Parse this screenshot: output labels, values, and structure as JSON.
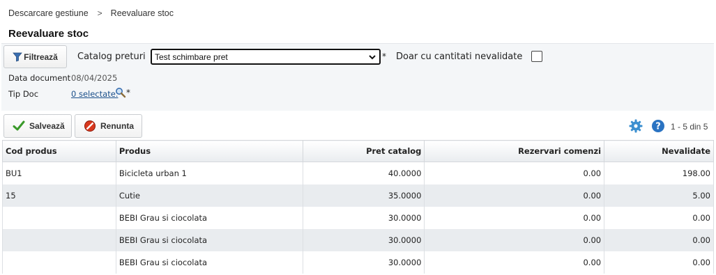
{
  "breadcrumb": {
    "root": "Descarcare gestiune",
    "separator": ">",
    "current": "Reevaluare stoc"
  },
  "page": {
    "title": "Reevaluare stoc"
  },
  "filters": {
    "filter_button": "Filtrează",
    "catalog_label": "Catalog preturi",
    "catalog_value": "Test schimbare pret",
    "required_mark": "*",
    "only_unvalidated_label": "Doar cu cantitati nevalidate",
    "only_unvalidated_checked": false,
    "doc_date_label": "Data document",
    "doc_date_value": "08/04/2025",
    "doc_type_label": "Tip Doc",
    "doc_type_value": "0 selectate."
  },
  "toolbar": {
    "save_label": "Salvează",
    "cancel_label": "Renunta",
    "pager": "1 - 5 din 5"
  },
  "table": {
    "columns": [
      "Cod produs",
      "Produs",
      "Pret catalog",
      "Rezervari comenzi",
      "Nevalidate"
    ],
    "rows": [
      {
        "cod": "BU1",
        "produs": "Bicicleta urban 1",
        "pret": "40.0000",
        "rezervari": "0.00",
        "nevalidate": "198.00"
      },
      {
        "cod": "15",
        "produs": "Cutie",
        "pret": "35.0000",
        "rezervari": "0.00",
        "nevalidate": "5.00"
      },
      {
        "cod": "",
        "produs": "BEBI Grau si ciocolata",
        "pret": "30.0000",
        "rezervari": "0.00",
        "nevalidate": "0.00"
      },
      {
        "cod": "",
        "produs": "BEBI Grau si ciocolata",
        "pret": "30.0000",
        "rezervari": "0.00",
        "nevalidate": "0.00"
      },
      {
        "cod": "",
        "produs": "BEBI Grau si ciocolata",
        "pret": "30.0000",
        "rezervari": "0.00",
        "nevalidate": "0.00"
      }
    ]
  },
  "colors": {
    "link": "#1a4f8a",
    "save_check": "#3a9a2a",
    "cancel_icon": "#d9381e",
    "gear": "#3b8fd0",
    "help": "#2a73c2"
  },
  "icons": [
    "filter-icon",
    "chevron-down-icon",
    "magnifier-icon",
    "checkmark-icon",
    "cancel-icon",
    "gear-icon",
    "help-icon"
  ]
}
